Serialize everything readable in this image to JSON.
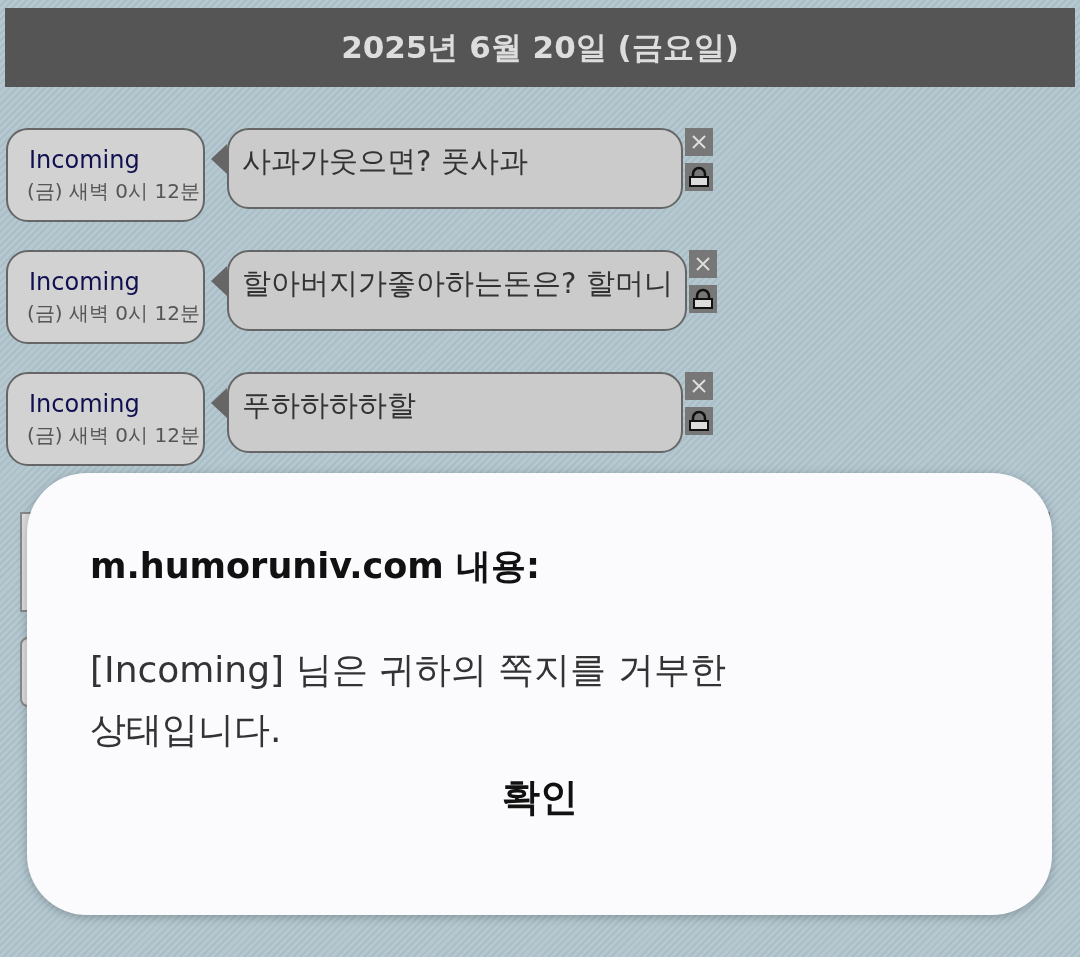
{
  "header": {
    "title": "2025년 6월 20일 (금요일)"
  },
  "messages": [
    {
      "sender": "Incoming",
      "time": "(금) 새벽 0시 12분",
      "text": "사과가웃으면? 풋사과"
    },
    {
      "sender": "Incoming",
      "time": "(금) 새벽 0시 12분",
      "text": "할아버지가좋아하는돈은? 할머니"
    },
    {
      "sender": "Incoming",
      "time": "(금) 새벽 0시 12분",
      "text": "푸하하하하할"
    }
  ],
  "dialog": {
    "title": "m.humoruniv.com 내용:",
    "message_lines": [
      "[Incoming] 님은 귀하의 쪽지를 거부한",
      "상태입니다."
    ],
    "button": "확인"
  }
}
